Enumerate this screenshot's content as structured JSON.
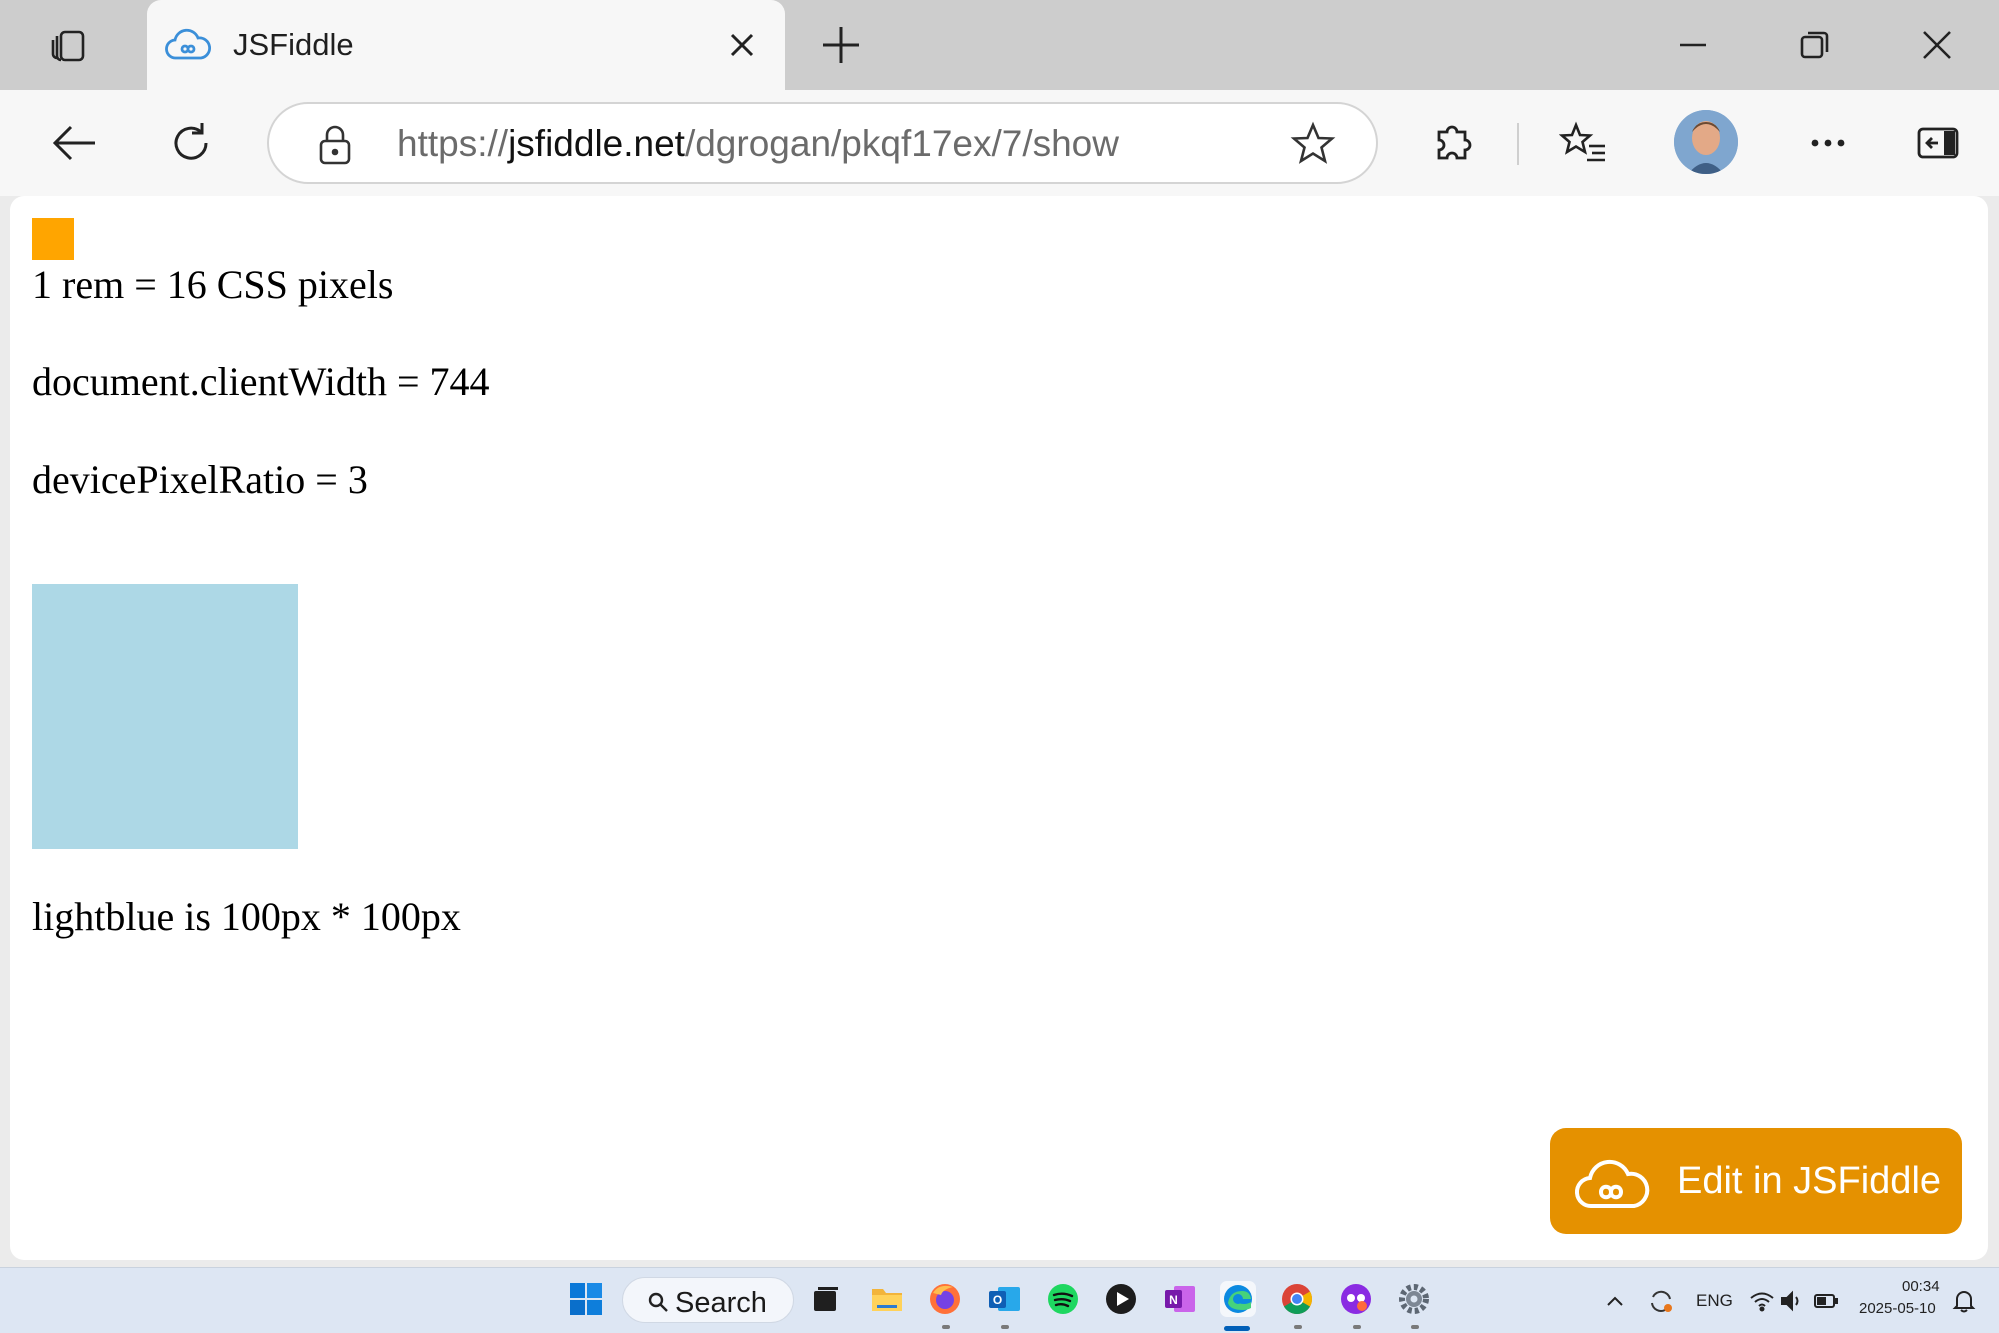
{
  "browser": {
    "tab": {
      "title": "JSFiddle"
    },
    "address": {
      "scheme": "https://",
      "host": "jsfiddle.net",
      "path": "/dgrogan/pkqf17ex/7/show"
    }
  },
  "page": {
    "line_rem": "1 rem = 16 CSS pixels",
    "line_client_width": "document.clientWidth = 744",
    "line_dpr": "devicePixelRatio = 3",
    "line_blue": "lightblue is 100px * 100px",
    "edit_button_label": "Edit in JSFiddle",
    "colors": {
      "orange_square": "#ffa500",
      "blue_square": "#add8e6",
      "edit_button": "#e59100"
    }
  },
  "taskbar": {
    "search_label": "Search",
    "lang": "ENG",
    "time": "00:34",
    "date": "2025-05-10",
    "apps": [
      "windows-start-icon",
      "task-view-icon",
      "file-explorer-icon",
      "firefox-icon",
      "outlook-icon",
      "spotify-icon",
      "media-player-icon",
      "onenote-icon",
      "edge-icon",
      "chrome-icon",
      "copilot-icon",
      "settings-icon"
    ]
  }
}
